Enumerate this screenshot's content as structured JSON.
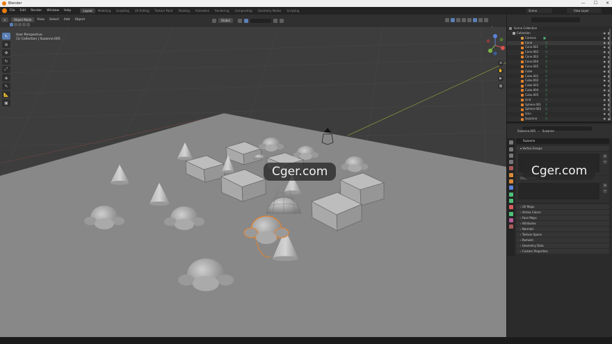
{
  "window": {
    "title": "Blender"
  },
  "menu": [
    "File",
    "Edit",
    "Render",
    "Window",
    "Help"
  ],
  "workspace_tabs": [
    "Layout",
    "Modeling",
    "Sculpting",
    "UV Editing",
    "Texture Paint",
    "Shading",
    "Animation",
    "Rendering",
    "Compositing",
    "Geometry Nodes",
    "Scripting"
  ],
  "active_workspace": "Layout",
  "scene": {
    "name": "Scene",
    "view_layer": "View Layer"
  },
  "viewport": {
    "mode": "Object Mode",
    "menus": [
      "View",
      "Select",
      "Add",
      "Object"
    ],
    "transform": "Global",
    "view_name": "User Perspective",
    "context": "(1) Collection | Suzanne.005",
    "options_label": "Options"
  },
  "outliner": {
    "scene_collection": "Scene Collection",
    "collection": "Collection",
    "items": [
      {
        "name": "Camera",
        "type": "camera"
      },
      {
        "name": "Cone",
        "type": "mesh"
      },
      {
        "name": "Cone.001",
        "type": "mesh"
      },
      {
        "name": "Cone.002",
        "type": "mesh"
      },
      {
        "name": "Cone.003",
        "type": "mesh"
      },
      {
        "name": "Cone.004",
        "type": "mesh"
      },
      {
        "name": "Cone.005",
        "type": "mesh"
      },
      {
        "name": "Cube",
        "type": "mesh"
      },
      {
        "name": "Cube.001",
        "type": "mesh"
      },
      {
        "name": "Cube.002",
        "type": "mesh"
      },
      {
        "name": "Cube.003",
        "type": "mesh"
      },
      {
        "name": "Cube.004",
        "type": "mesh"
      },
      {
        "name": "Cube.005",
        "type": "mesh"
      },
      {
        "name": "Grid",
        "type": "mesh"
      },
      {
        "name": "Sphere.001",
        "type": "mesh"
      },
      {
        "name": "Sphere.002",
        "type": "mesh"
      },
      {
        "name": "Sirin",
        "type": "mesh"
      },
      {
        "name": "Suzanne",
        "type": "mesh"
      }
    ]
  },
  "properties": {
    "breadcrumb_object": "Suzanne.005",
    "breadcrumb_data": "Suzanne",
    "data_name": "Suzanne",
    "sections": {
      "vertex_groups": "Vertex Groups",
      "shape_keys": "Shape Keys",
      "uv_maps": "UV Maps",
      "vertex_colors": "Vertex Colors",
      "face_maps": "Face Maps",
      "attributes": "Attributes",
      "normals": "Normals",
      "texture_space": "Texture Space",
      "remesh": "Remesh",
      "geometry_data": "Geometry Data",
      "custom_properties": "Custom Properties"
    }
  },
  "watermark": "Cger.com",
  "colors": {
    "accent": "#5b7fb5",
    "selected_outline": "#e8832a",
    "mesh_icon": "#e8832a",
    "modifier_icon": "#4fbf7a"
  }
}
